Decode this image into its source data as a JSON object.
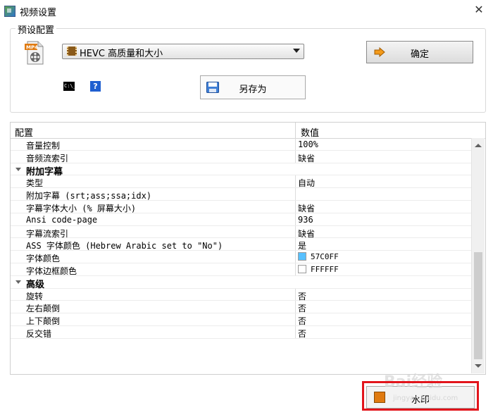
{
  "window": {
    "title": "视频设置",
    "close_glyph": "✕"
  },
  "preset": {
    "group_label": "预设配置",
    "selected": "HEVC 高质量和大小",
    "ok_label": "确定",
    "save_as_label": "另存为",
    "help_glyph": "?",
    "cmd_glyph": "C:\\_"
  },
  "table": {
    "col_key": "配置",
    "col_value": "数值",
    "rows": [
      {
        "type": "item",
        "key": "音量控制",
        "value": "100%"
      },
      {
        "type": "item",
        "key": "音频流索引",
        "value": "缺省"
      },
      {
        "type": "category",
        "key": "附加字幕"
      },
      {
        "type": "item",
        "key": "类型",
        "value": "自动"
      },
      {
        "type": "item",
        "key": "附加字幕 (srt;ass;ssa;idx)",
        "value": ""
      },
      {
        "type": "item",
        "key": "字幕字体大小 (% 屏幕大小)",
        "value": "缺省"
      },
      {
        "type": "item",
        "key": "Ansi code-page",
        "value": "936"
      },
      {
        "type": "item",
        "key": "字幕流索引",
        "value": "缺省"
      },
      {
        "type": "item",
        "key": "ASS 字体颜色 (Hebrew Arabic set to \"No\")",
        "value": "是"
      },
      {
        "type": "color",
        "key": "字体颜色",
        "value": "57C0FF",
        "swatch": "#57C0FF"
      },
      {
        "type": "color",
        "key": "字体边框颜色",
        "value": "FFFFFF",
        "swatch": "#FFFFFF"
      },
      {
        "type": "category",
        "key": "高级"
      },
      {
        "type": "item",
        "key": "旋转",
        "value": "否"
      },
      {
        "type": "item",
        "key": "左右颠倒",
        "value": "否"
      },
      {
        "type": "item",
        "key": "上下颠倒",
        "value": "否"
      },
      {
        "type": "item",
        "key": "反交错",
        "value": "否"
      }
    ]
  },
  "footer": {
    "watermark_label": "水印"
  },
  "overlay": {
    "baidu_text": "Bai经验",
    "baidu_url": "jingyan.baidu.com"
  },
  "colors": {
    "highlight": "#E2141B",
    "accent_orange": "#E07A10"
  }
}
